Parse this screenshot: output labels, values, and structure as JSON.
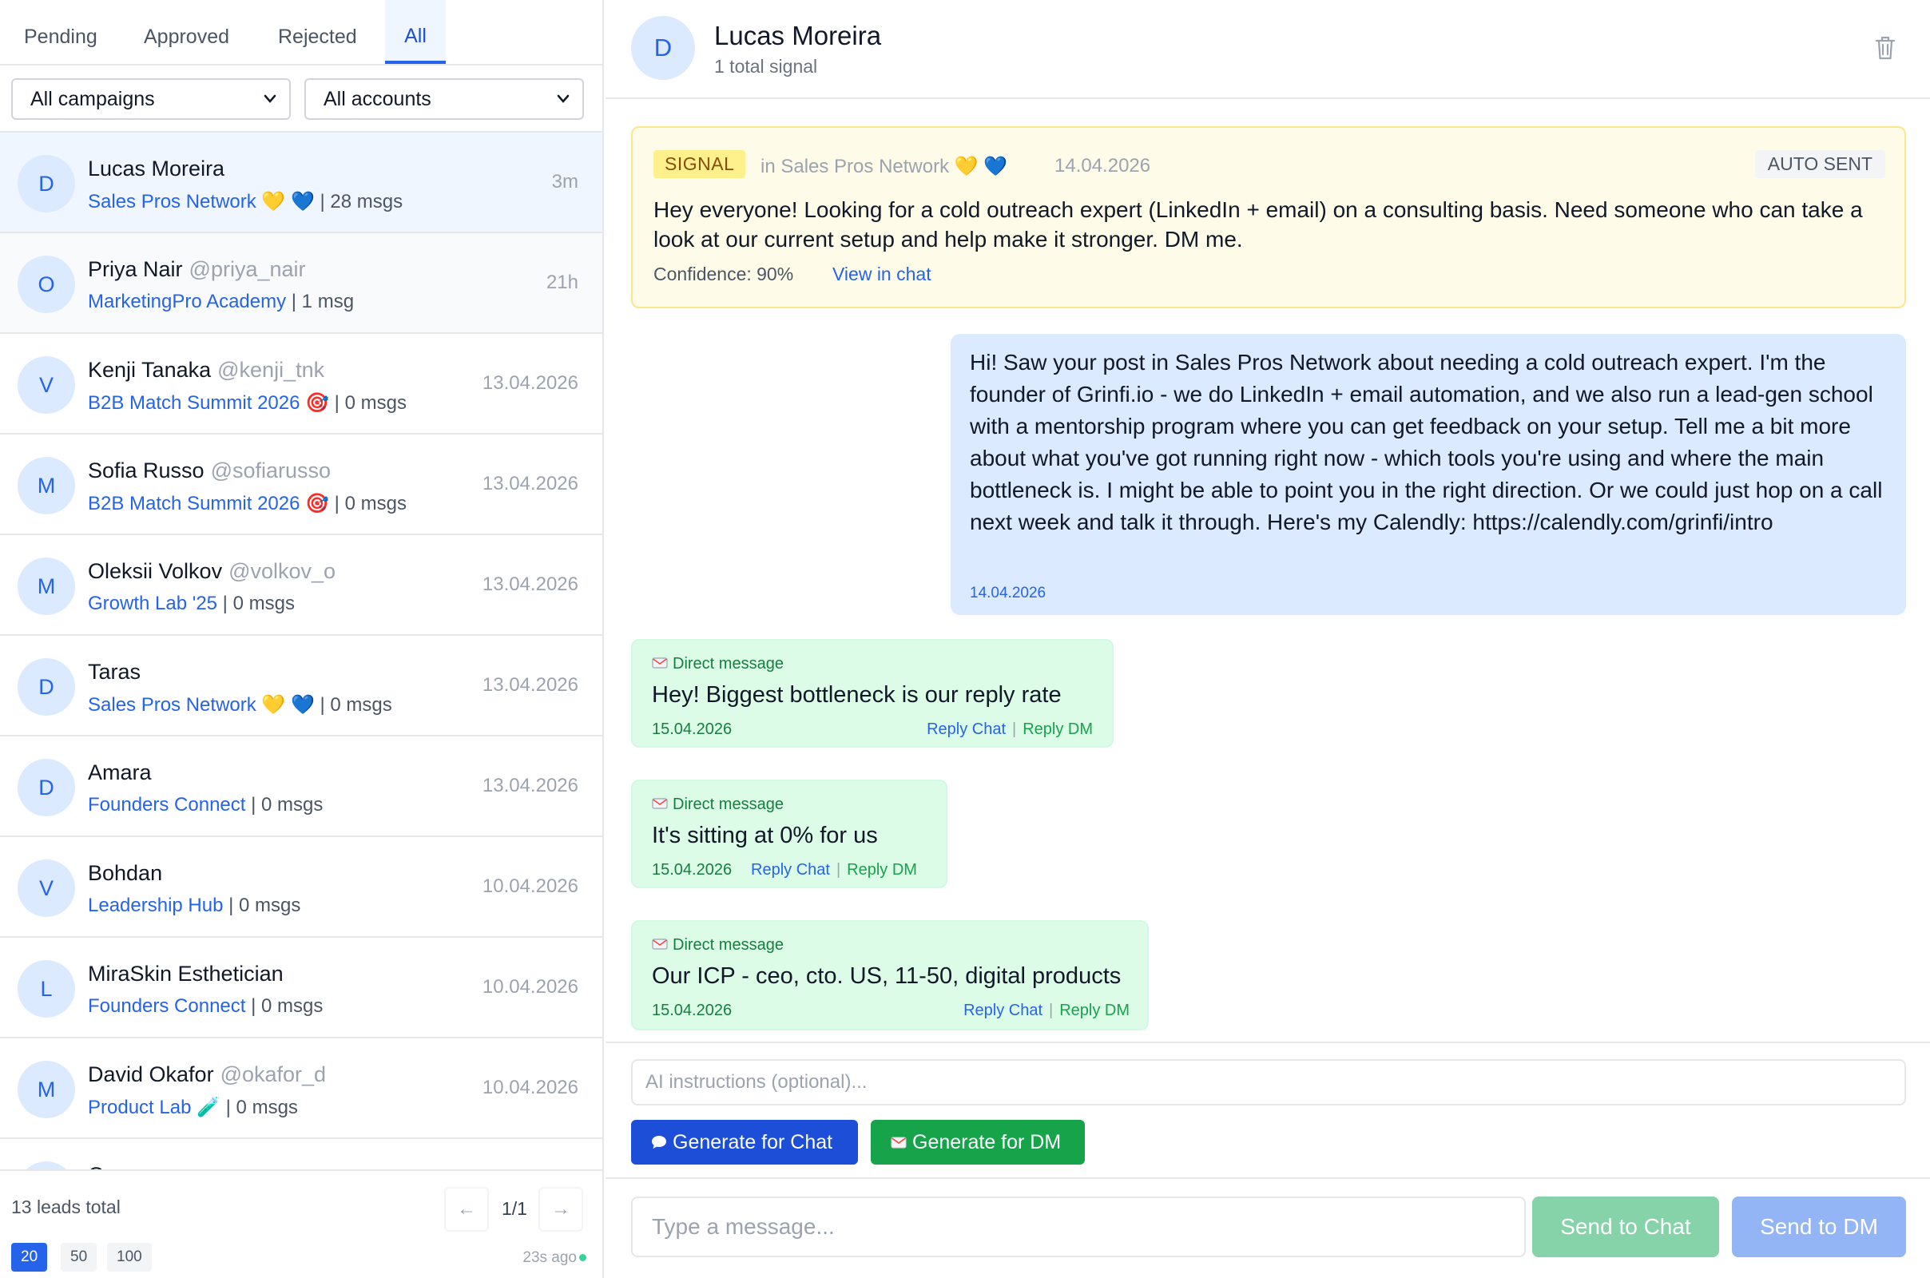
{
  "tabs": [
    {
      "label": "Pending",
      "active": false
    },
    {
      "label": "Approved",
      "active": false
    },
    {
      "label": "Rejected",
      "active": false
    },
    {
      "label": "All",
      "active": true
    }
  ],
  "filters": {
    "campaign": "All campaigns",
    "account": "All accounts"
  },
  "leads": [
    {
      "initial": "D",
      "name": "Lucas Moreira",
      "handle": "",
      "campaign": "Sales Pros Network 💛 💙",
      "msgs": " | 28 msgs",
      "time": "3m"
    },
    {
      "initial": "O",
      "name": "Priya Nair",
      "handle": "@priya_nair",
      "campaign": "MarketingPro Academy",
      "msgs": " | 1 msg",
      "time": "21h"
    },
    {
      "initial": "V",
      "name": "Kenji Tanaka",
      "handle": "@kenji_tnk",
      "campaign": "B2B Match Summit 2026 🎯",
      "msgs": " | 0 msgs",
      "time": "13.04.2026"
    },
    {
      "initial": "M",
      "name": "Sofia Russo",
      "handle": "@sofiarusso",
      "campaign": "B2B Match Summit 2026 🎯",
      "msgs": " | 0 msgs",
      "time": "13.04.2026"
    },
    {
      "initial": "M",
      "name": "Oleksii Volkov",
      "handle": "@volkov_o",
      "campaign": "Growth Lab '25",
      "msgs": " | 0 msgs",
      "time": "13.04.2026"
    },
    {
      "initial": "D",
      "name": "Taras",
      "handle": "",
      "campaign": "Sales Pros Network 💛 💙",
      "msgs": " | 0 msgs",
      "time": "13.04.2026"
    },
    {
      "initial": "D",
      "name": "Amara",
      "handle": "",
      "campaign": "Founders Connect",
      "msgs": " | 0 msgs",
      "time": "13.04.2026"
    },
    {
      "initial": "V",
      "name": "Bohdan",
      "handle": "",
      "campaign": "Leadership Hub",
      "msgs": " | 0 msgs",
      "time": "10.04.2026"
    },
    {
      "initial": "L",
      "name": "MiraSkin Esthetician",
      "handle": "",
      "campaign": "Founders Connect",
      "msgs": " | 0 msgs",
      "time": "10.04.2026"
    },
    {
      "initial": "M",
      "name": "David Okafor",
      "handle": "@okafor_d",
      "campaign": "Product Lab 🧪",
      "msgs": " | 0 msgs",
      "time": "10.04.2026"
    },
    {
      "initial": "",
      "name": "O",
      "handle": "",
      "campaign": "",
      "msgs": "",
      "time": ""
    }
  ],
  "footer": {
    "total": "13 leads total",
    "page": "1/1",
    "prev_icon": "←",
    "next_icon": "→",
    "page_sizes": [
      "20",
      "50",
      "100"
    ],
    "active_page_size": "20",
    "updated": "23s ago"
  },
  "chat": {
    "avatar": "D",
    "name": "Lucas Moreira",
    "subtitle": "1 total signal",
    "trash_icon": "trash-icon"
  },
  "signal": {
    "tag": "SIGNAL",
    "in": "in Sales Pros Network 💛 💙",
    "date": "14.04.2026",
    "status": "AUTO SENT",
    "text": "Hey everyone! Looking for a cold outreach expert (LinkedIn + email) on a consulting basis. Need someone who can take a look at our current setup and help make it stronger. DM me.",
    "confidence": "Confidence: 90%",
    "view_link": "View in chat"
  },
  "outgoing": {
    "text": "Hi! Saw your post in Sales Pros Network about needing a cold outreach expert. I'm the founder of Grinfi.io - we do LinkedIn + email automation, and we also run a lead-gen school with a mentorship program where you can get feedback on your setup. Tell me a bit more about what you've got running right now - which tools you're using and where the main bottleneck is. I might be able to point you in the right direction. Or we could just hop on a call next week and talk it through. Here's my Calendly: https://calendly.com/grinfi/intro",
    "time": "14.04.2026"
  },
  "direct_messages": [
    {
      "label": "Direct message",
      "text": "Hey! Biggest bottleneck is our reply rate",
      "date": "15.04.2026",
      "reply_chat": "Reply Chat",
      "sep": "|",
      "reply_dm": "Reply DM"
    },
    {
      "label": "Direct message",
      "text": "It's sitting at 0% for us",
      "date": "15.04.2026",
      "reply_chat": "Reply Chat",
      "sep": "|",
      "reply_dm": "Reply DM"
    },
    {
      "label": "Direct message",
      "text": "Our ICP - ceo, cto. US, 11-50, digital products",
      "date": "15.04.2026",
      "reply_chat": "Reply Chat",
      "sep": "|",
      "reply_dm": "Reply DM"
    }
  ],
  "composer": {
    "ai_placeholder": "AI instructions (optional)...",
    "gen_chat": "Generate for Chat",
    "gen_dm": "Generate for DM",
    "message_placeholder": "Type a message...",
    "send_chat": "Send to Chat",
    "send_dm": "Send to DM"
  },
  "colors": {
    "accent": "#2563eb",
    "success": "#16a34a",
    "signal_bg": "#fefce8",
    "outgoing_bg": "#dbeafe",
    "dm_bg": "#dcfce7"
  }
}
